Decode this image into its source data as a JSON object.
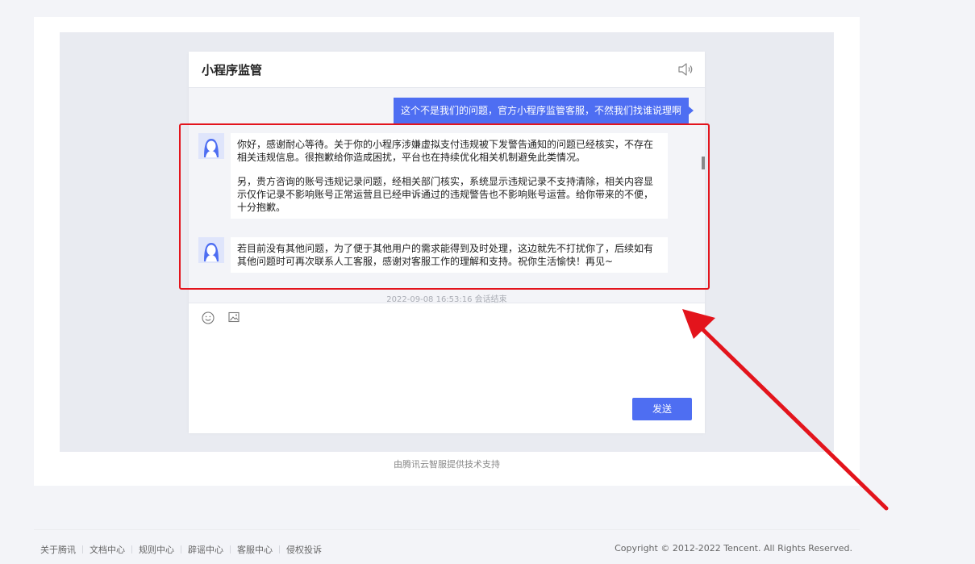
{
  "chat": {
    "title": "小程序监管",
    "icons": {
      "speaker": "speaker-icon",
      "emoji": "emoji-icon",
      "image": "image-icon",
      "avatar": "agent-avatar"
    },
    "messages": {
      "user_1": "这个不是我们的问题，官方小程序监管客服，不然我们找谁说理啊",
      "agent_1_p1": "你好，感谢耐心等待。关于你的小程序涉嫌虚拟支付违规被下发警告通知的问题已经核实，不存在相关违规信息。很抱歉给你造成困扰，平台也在持续优化相关机制避免此类情况。",
      "agent_1_p2": "另，贵方咨询的账号违规记录问题，经相关部门核实，系统显示违规记录不支持清除，相关内容显示仅作记录不影响账号正常运营且已经申诉通过的违规警告也不影响账号运营。给你带来的不便，十分抱歉。",
      "agent_2": "若目前没有其他问题，为了便于其他用户的需求能得到及时处理，这边就先不打扰你了，后续如有其他问题时可再次联系人工客服，感谢对客服工作的理解和支持。祝你生活愉快！再见~"
    },
    "end_notice": "2022-09-08 16:53:16 会话结束",
    "send_label": "发送"
  },
  "powered_by": "由腾讯云智服提供技术支持",
  "footer": {
    "links": [
      "关于腾讯",
      "文档中心",
      "规则中心",
      "辟谣中心",
      "客服中心",
      "侵权投诉"
    ],
    "copyright": "Copyright © 2012-2022 Tencent. All Rights Reserved."
  },
  "colors": {
    "accent": "#4e6ef2",
    "highlight": "#e3141c",
    "background": "#f3f4f8"
  }
}
